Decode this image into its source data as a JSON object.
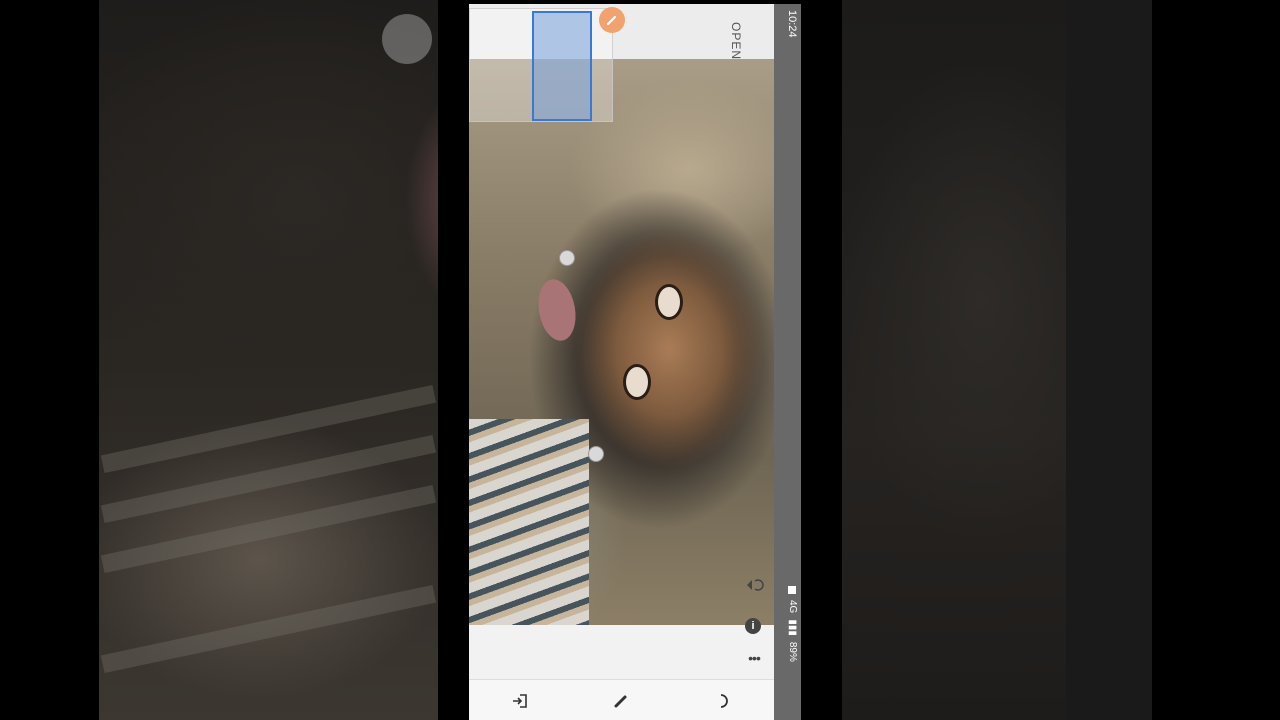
{
  "status_bar": {
    "time": "10:24",
    "battery": "89%",
    "network": "4G"
  },
  "app_bar": {
    "open_label": "OPEN"
  },
  "bottom_toolbar": {
    "items": [
      {
        "icon": "exit-icon"
      },
      {
        "icon": "pencil-icon"
      },
      {
        "icon": "moon-icon"
      }
    ]
  },
  "overlay": {
    "info_label": "i",
    "more_label": "•••"
  },
  "colors": {
    "selection": "#3a78d6",
    "pen_badge": "#f2a26e",
    "status_bar": "#696969"
  }
}
